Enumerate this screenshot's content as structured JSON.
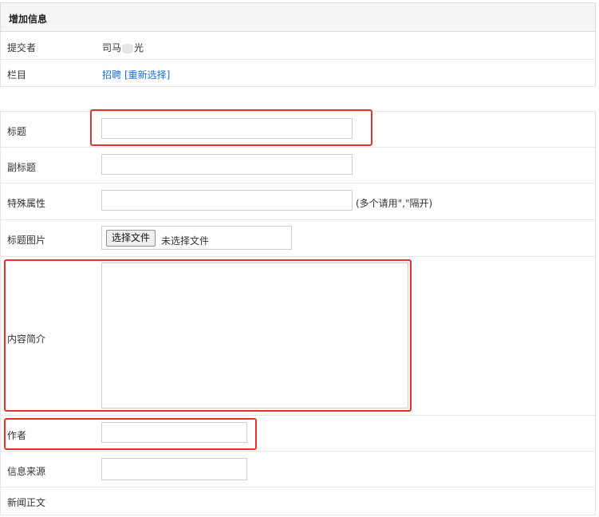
{
  "header": {
    "title": "增加信息"
  },
  "info": {
    "submitter_label": "提交者",
    "submitter_value_a": "司马",
    "submitter_value_b": "光",
    "column_label": "栏目",
    "column_value": "招聘",
    "reselect_link": "[重新选择]"
  },
  "form": {
    "title_label": "标题",
    "title_value": "",
    "subtitle_label": "副标题",
    "subtitle_value": "",
    "special_label": "特殊属性",
    "special_value": "",
    "special_hint": "(多个请用\",\"隔开)",
    "title_image_label": "标题图片",
    "file_button": "选择文件",
    "file_status": "未选择文件",
    "summary_label": "内容简介",
    "summary_value": "",
    "author_label": "作者",
    "author_value": "",
    "source_label": "信息来源",
    "source_value": "",
    "body_label": "新闻正文"
  },
  "highlight_color": "#e5322d",
  "link_color": "#1a6fd1"
}
